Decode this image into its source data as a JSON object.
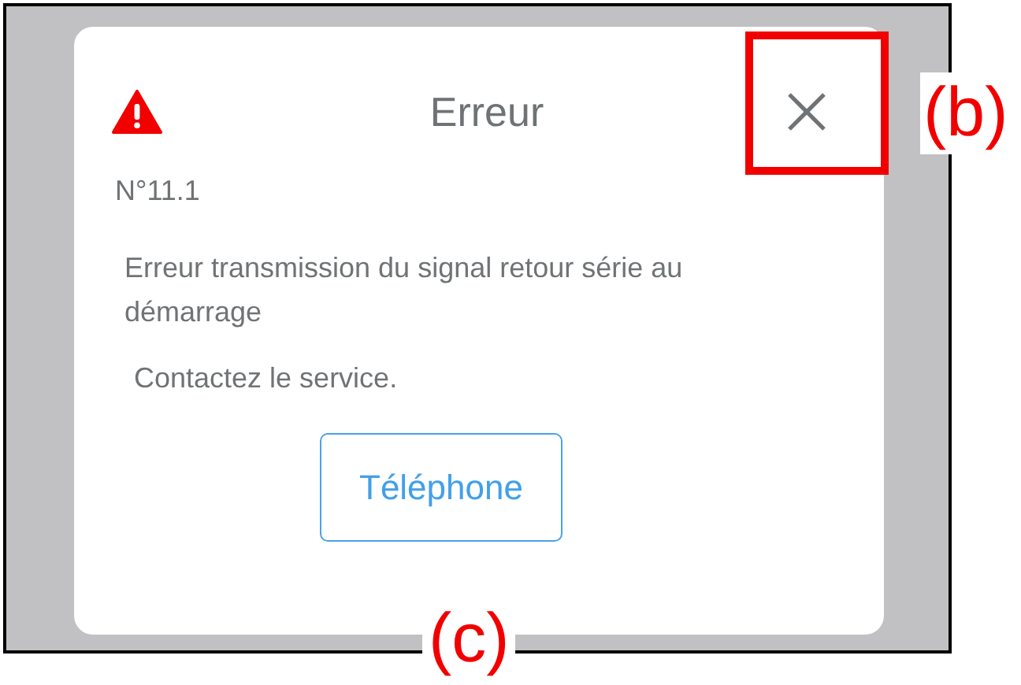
{
  "dialog": {
    "title": "Erreur",
    "code": "N°11.1",
    "message": "Erreur transmission du signal retour série au démarrage",
    "instruction": "Contactez le service.",
    "button": "Téléphone"
  },
  "annotations": [
    {
      "label": "(b)"
    },
    {
      "label": "(c)"
    }
  ]
}
